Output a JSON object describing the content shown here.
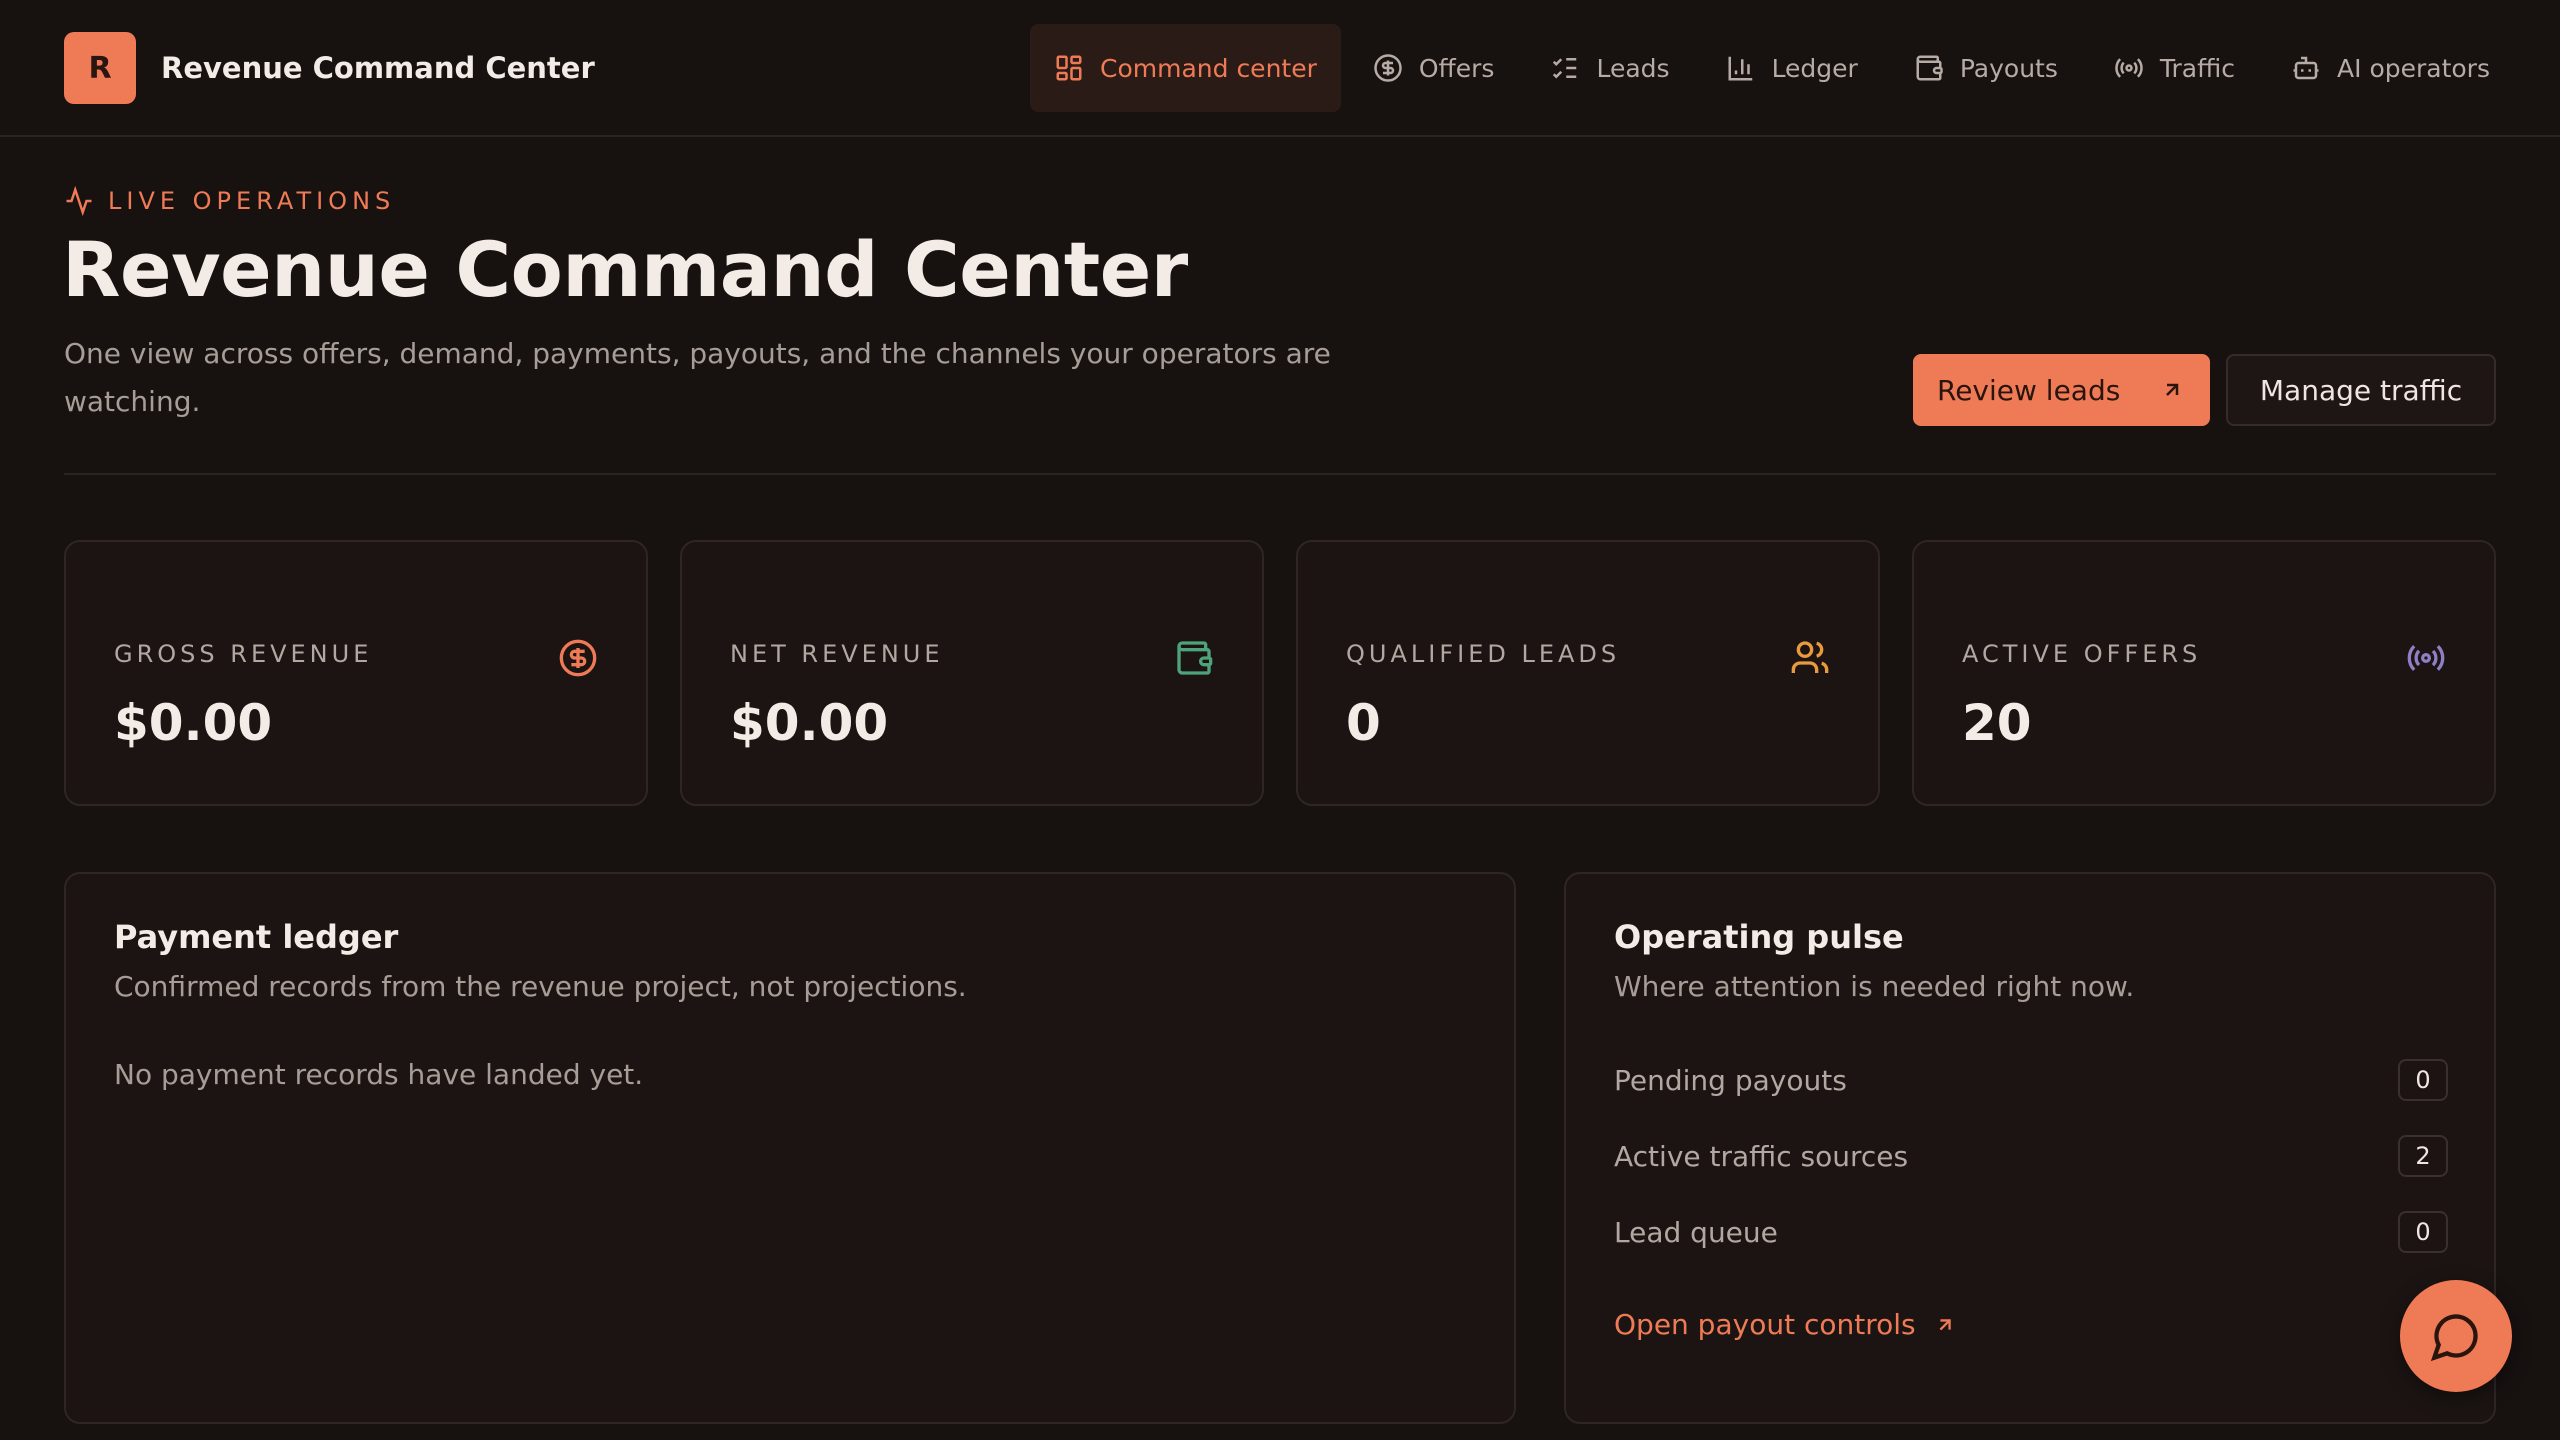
{
  "brand": {
    "logo_letter": "R",
    "name": "Revenue Command Center"
  },
  "nav": [
    {
      "label": "Command center",
      "icon": "grid-icon",
      "active": true
    },
    {
      "label": "Offers",
      "icon": "dollar-circle-icon"
    },
    {
      "label": "Leads",
      "icon": "checklist-icon"
    },
    {
      "label": "Ledger",
      "icon": "bar-chart-icon"
    },
    {
      "label": "Payouts",
      "icon": "wallet-icon"
    },
    {
      "label": "Traffic",
      "icon": "broadcast-icon"
    },
    {
      "label": "AI operators",
      "icon": "bot-icon"
    }
  ],
  "hero": {
    "eyebrow": "LIVE OPERATIONS",
    "eyebrow_icon": "activity-icon",
    "title": "Revenue Command Center",
    "subtitle": "One view across offers, demand, payments, payouts, and the channels your operators are watching.",
    "primary_button": "Review leads",
    "secondary_button": "Manage traffic"
  },
  "stats": [
    {
      "label": "GROSS REVENUE",
      "value": "$0.00",
      "icon": "dollar-circle-icon",
      "color": "#ef7b56"
    },
    {
      "label": "NET REVENUE",
      "value": "$0.00",
      "icon": "wallet-icon",
      "color": "#4fa37a"
    },
    {
      "label": "QUALIFIED LEADS",
      "value": "0",
      "icon": "users-icon",
      "color": "#e89a3c"
    },
    {
      "label": "ACTIVE OFFERS",
      "value": "20",
      "icon": "broadcast-icon",
      "color": "#8f7fc4"
    }
  ],
  "ledger": {
    "title": "Payment ledger",
    "subtitle": "Confirmed records from the revenue project, not projections.",
    "empty": "No payment records have landed yet."
  },
  "pulse": {
    "title": "Operating pulse",
    "subtitle": "Where attention is needed right now.",
    "rows": [
      {
        "label": "Pending payouts",
        "count": "0"
      },
      {
        "label": "Active traffic sources",
        "count": "2"
      },
      {
        "label": "Lead queue",
        "count": "0"
      }
    ],
    "link": "Open payout controls"
  },
  "colors": {
    "accent": "#ef7b56",
    "background": "#171110",
    "card": "#1b1412"
  }
}
